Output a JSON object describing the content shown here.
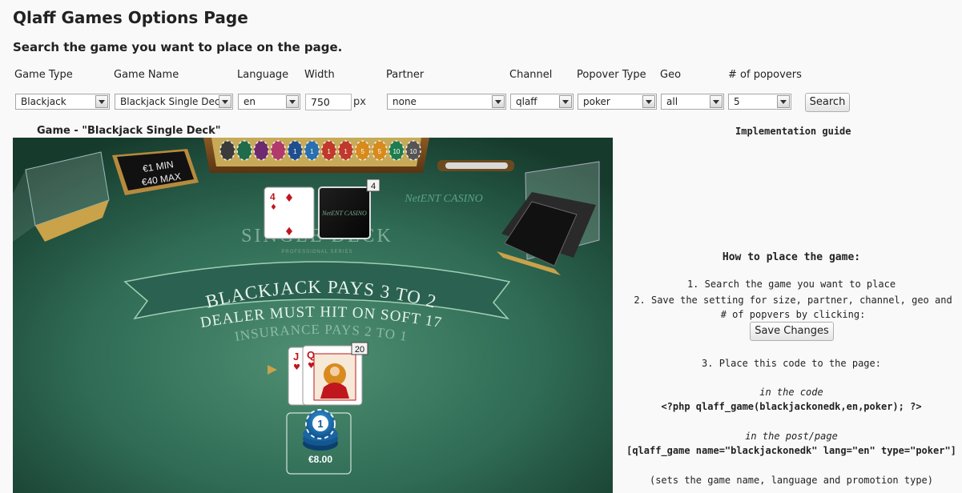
{
  "page_title": "Qlaff Games Options Page",
  "subtitle": "Search the game you want to place on the page.",
  "filters": {
    "game_type": {
      "label": "Game Type",
      "value": "Blackjack"
    },
    "game_name": {
      "label": "Game Name",
      "value": "Blackjack Single Deck"
    },
    "language": {
      "label": "Language",
      "value": "en"
    },
    "width": {
      "label": "Width",
      "value": "750",
      "unit": "px"
    },
    "partner": {
      "label": "Partner",
      "value": "none"
    },
    "channel": {
      "label": "Channel",
      "value": "qlaff"
    },
    "popover_type": {
      "label": "Popover Type",
      "value": "poker"
    },
    "geo": {
      "label": "Geo",
      "value": "all"
    },
    "num_popovers": {
      "label": "# of popovers",
      "value": "5"
    },
    "search_button": "Search"
  },
  "game": {
    "caption": "Game - \"Blackjack Single Deck\"",
    "min_bet": "€1 MIN",
    "max_bet": "€40 MAX",
    "table_title": "SINGLE DECK",
    "table_subtitle": "PROFESSIONAL SERIES",
    "casino_logo": "NetENT CASINO",
    "banner_text": "BLACKJACK PAYS 3 TO 2",
    "dealer_rule": "DEALER MUST HIT ON SOFT 17",
    "insurance_text": "INSURANCE PAYS 2 TO 1",
    "dealer_card_rank": "4",
    "dealer_card_suit": "♦",
    "dealer_total": "4",
    "player_card1_rank": "J",
    "player_card2_rank": "Q",
    "player_card_suit": "♥",
    "player_total": "20",
    "bet_chip_value": "1",
    "bet_amount": "€8.00",
    "chip_rack_labels": [
      "1",
      "1",
      "1",
      "1",
      "5",
      "5",
      "10",
      "10"
    ],
    "colors": {
      "felt": "#2f6b55",
      "felt_dark": "#163a2c",
      "gold": "#c9a24a"
    }
  },
  "guide": {
    "title": "Implementation guide",
    "how_to": "How to place the game:",
    "step1": "1. Search the game you want to place",
    "step2": "2. Save the setting for size, partner, channel, geo and # of popvers by clicking:",
    "save_button": "Save Changes",
    "step3": "3. Place this code to the page:",
    "in_code_label": "in the code",
    "php_code": "<?php qlaff_game(blackjackonedk,en,poker); ?>",
    "in_post_label": "in the post/page",
    "shortcode": "[qlaff_game name=\"blackjackonedk\" lang=\"en\" type=\"poker\"]",
    "note": "(sets the game name, language and promotion type)"
  }
}
